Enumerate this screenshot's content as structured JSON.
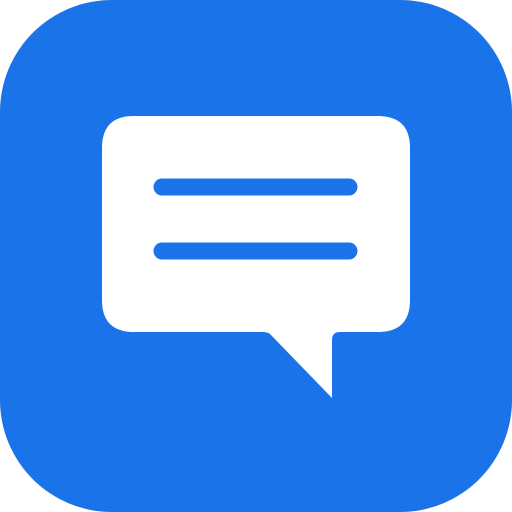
{
  "icon": {
    "name": "chat-bubble-icon",
    "background_color": "#1A73E8",
    "bubble_color": "#FFFFFF",
    "line_color": "#1A73E8"
  }
}
